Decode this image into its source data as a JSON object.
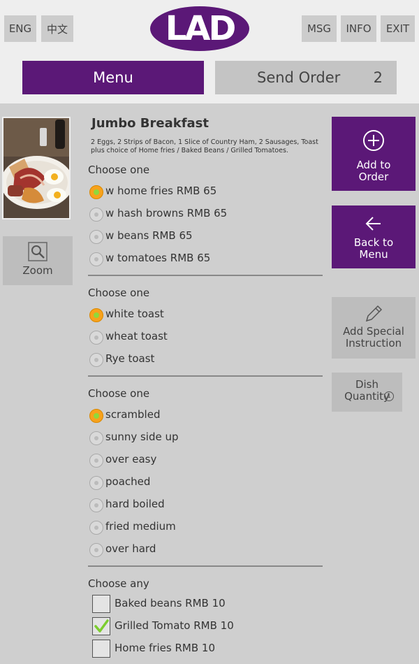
{
  "header": {
    "lang_en": "ENG",
    "lang_zh": "中文",
    "logo_text": "LAD",
    "msg": "MSG",
    "info": "INFO",
    "exit": "EXIT"
  },
  "nav": {
    "menu": "Menu",
    "send_order": "Send Order",
    "order_count": "2"
  },
  "colors": {
    "accent": "#5b1877",
    "selected": "#f7a21c",
    "dot": "#8fd83b"
  },
  "left": {
    "zoom": "Zoom"
  },
  "dish": {
    "title": "Jumbo Breakfast",
    "description": "2 Eggs, 2 Strips of Bacon, 1 Slice of Country Ham, 2 Sausages, Toast plus choice of Home fries / Baked Beans / Grilled Tomatoes."
  },
  "groups": [
    {
      "label": "Choose one",
      "options": [
        {
          "label": "w home fries RMB 65",
          "selected": true
        },
        {
          "label": "w hash browns RMB 65",
          "selected": false
        },
        {
          "label": "w beans RMB 65",
          "selected": false
        },
        {
          "label": "w tomatoes RMB 65",
          "selected": false
        }
      ]
    },
    {
      "label": "Choose one",
      "options": [
        {
          "label": "white toast",
          "selected": true
        },
        {
          "label": "wheat toast",
          "selected": false
        },
        {
          "label": "Rye toast",
          "selected": false
        }
      ]
    },
    {
      "label": "Choose one",
      "options": [
        {
          "label": "scrambled",
          "selected": true
        },
        {
          "label": "sunny side up",
          "selected": false
        },
        {
          "label": "over easy",
          "selected": false
        },
        {
          "label": "poached",
          "selected": false
        },
        {
          "label": "hard boiled",
          "selected": false
        },
        {
          "label": "fried medium",
          "selected": false
        },
        {
          "label": "over hard",
          "selected": false
        }
      ]
    },
    {
      "label": "Choose any",
      "options": [
        {
          "label": "Baked beans RMB 10",
          "checked": false
        },
        {
          "label": "Grilled Tomato RMB 10",
          "checked": true
        },
        {
          "label": "Home fries RMB 10",
          "checked": false
        }
      ]
    }
  ],
  "actions": {
    "add_to_order": "Add to Order",
    "back_to_menu": "Back to Menu",
    "special_instruction": "Add Special Instruction",
    "dish_quantity_label": "Dish Quantity",
    "dish_quantity": "1"
  }
}
